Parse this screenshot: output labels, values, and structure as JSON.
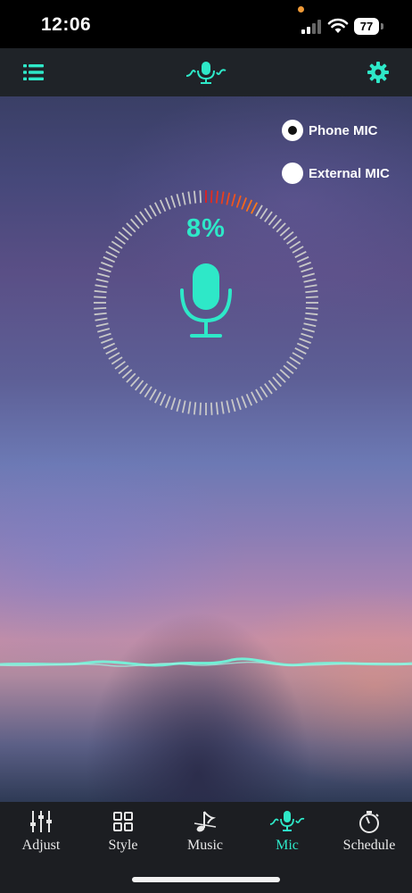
{
  "status_bar": {
    "time": "12:06",
    "battery": "77"
  },
  "header": {
    "menu_icon": "list-icon",
    "logo_icon": "mic-wave-icon",
    "settings_icon": "gear-icon"
  },
  "mic_source": {
    "options": [
      {
        "label": "Phone MIC",
        "selected": true
      },
      {
        "label": "External MIC",
        "selected": false
      }
    ]
  },
  "meter": {
    "percent_text": "8%",
    "level": 0.08
  },
  "colors": {
    "accent": "#2ee8c8",
    "header_bg": "#1f2328",
    "nav_bg": "#1c1e22",
    "meter_tick": "#c8c8c8",
    "meter_active_start": "#e02020",
    "meter_active_end": "#ff7a18"
  },
  "bottom_nav": {
    "items": [
      {
        "label": "Adjust",
        "icon": "sliders-icon",
        "active": false
      },
      {
        "label": "Style",
        "icon": "grid-icon",
        "active": false
      },
      {
        "label": "Music",
        "icon": "music-note-icon",
        "active": false
      },
      {
        "label": "Mic",
        "icon": "mic-wave-icon",
        "active": true
      },
      {
        "label": "Schedule",
        "icon": "timer-icon",
        "active": false
      }
    ]
  }
}
